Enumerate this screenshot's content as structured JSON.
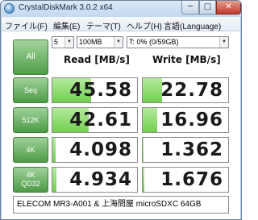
{
  "window": {
    "title": "CrystalDiskMark 3.0.2 x64",
    "min_label": "─",
    "max_label": "□",
    "close_label": "✕"
  },
  "menu": [
    "ファイル(F)",
    "編集(E)",
    "テーマ(T)",
    "ヘルプ(H)",
    "言語(Language)"
  ],
  "controls": {
    "all_label": "All",
    "count": "5",
    "size": "100MB",
    "drive": "T: 0% (0/59GB)"
  },
  "headers": {
    "read": "Read [MB/s]",
    "write": "Write [MB/s]"
  },
  "rows": [
    {
      "label_line1": "Seq",
      "label_line2": "",
      "read": "45.58",
      "write": "22.78",
      "read_fill": 0.46,
      "write_fill": 0.23
    },
    {
      "label_line1": "512K",
      "label_line2": "",
      "read": "42.61",
      "write": "16.96",
      "read_fill": 0.43,
      "write_fill": 0.17
    },
    {
      "label_line1": "4K",
      "label_line2": "",
      "read": "4.098",
      "write": "1.362",
      "read_fill": 0.041,
      "write_fill": 0.014
    },
    {
      "label_line1": "4K",
      "label_line2": "QD32",
      "read": "4.934",
      "write": "1.676",
      "read_fill": 0.049,
      "write_fill": 0.017
    }
  ],
  "comment": "ELECOM MR3-A001 & 上海問屋 microSDXC 64GB",
  "colors": {
    "accent_green": "#4f9e48",
    "bar_green": "#72cf4f"
  }
}
